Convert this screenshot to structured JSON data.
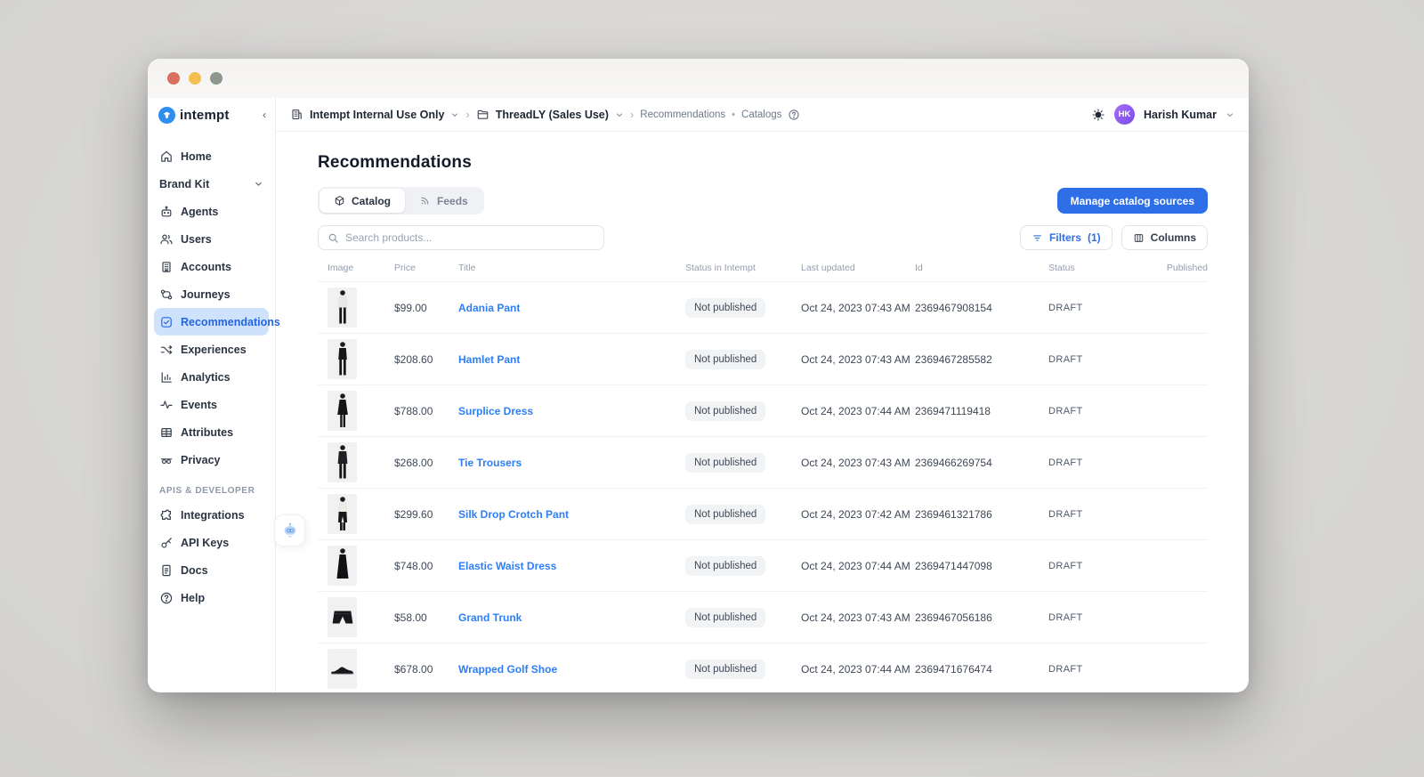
{
  "window": {
    "controls": [
      "close",
      "minimize",
      "maximize"
    ]
  },
  "sidebar": {
    "logo_text": "intempt",
    "collapse_glyph": "‹",
    "items": [
      {
        "label": "Home",
        "icon": "home-icon"
      },
      {
        "label": "Brand Kit",
        "icon": null,
        "chevron": true
      },
      {
        "label": "Agents",
        "icon": "robot-icon"
      },
      {
        "label": "Users",
        "icon": "users-icon"
      },
      {
        "label": "Accounts",
        "icon": "building-icon"
      },
      {
        "label": "Journeys",
        "icon": "journey-icon"
      },
      {
        "label": "Recommendations",
        "icon": "recommendation-icon",
        "selected": true
      },
      {
        "label": "Experiences",
        "icon": "shuffle-icon"
      },
      {
        "label": "Analytics",
        "icon": "bar-chart-icon"
      },
      {
        "label": "Events",
        "icon": "pulse-icon"
      },
      {
        "label": "Attributes",
        "icon": "table-icon"
      },
      {
        "label": "Privacy",
        "icon": "mask-icon"
      }
    ],
    "section_label": "APIS & DEVELOPER",
    "dev_items": [
      {
        "label": "Integrations",
        "icon": "puzzle-icon"
      },
      {
        "label": "API Keys",
        "icon": "key-icon"
      },
      {
        "label": "Docs",
        "icon": "document-icon"
      },
      {
        "label": "Help",
        "icon": "help-circle-icon"
      }
    ]
  },
  "topbar": {
    "org": "Intempt Internal Use Only",
    "project": "ThreadLY (Sales Use)",
    "section": "Recommendations",
    "page": "Catalogs",
    "separator": "›",
    "dot_separator": "•",
    "user_name": "Harish Kumar",
    "user_initials": "HK"
  },
  "main": {
    "title": "Recommendations",
    "tabs": [
      {
        "label": "Catalog",
        "icon": "package-icon",
        "active": true
      },
      {
        "label": "Feeds",
        "icon": "rss-icon",
        "active": false
      }
    ],
    "manage_button": "Manage catalog sources",
    "search_placeholder": "Search products...",
    "filters_label": "Filters",
    "filters_count": "(1)",
    "columns_label": "Columns"
  },
  "table": {
    "headers": [
      "Image",
      "Price",
      "Title",
      "Status in Intempt",
      "Last updated",
      "Id",
      "Status",
      "Published"
    ],
    "rows": [
      {
        "price": "$99.00",
        "title": "Adania Pant",
        "status_intempt": "Not published",
        "last_updated": "Oct 24, 2023 07:43 AM",
        "id": "2369467908154",
        "status": "DRAFT"
      },
      {
        "price": "$208.60",
        "title": "Hamlet Pant",
        "status_intempt": "Not published",
        "last_updated": "Oct 24, 2023 07:43 AM",
        "id": "2369467285582",
        "status": "DRAFT"
      },
      {
        "price": "$788.00",
        "title": "Surplice Dress",
        "status_intempt": "Not published",
        "last_updated": "Oct 24, 2023 07:44 AM",
        "id": "2369471119418",
        "status": "DRAFT"
      },
      {
        "price": "$268.00",
        "title": "Tie Trousers",
        "status_intempt": "Not published",
        "last_updated": "Oct 24, 2023 07:43 AM",
        "id": "2369466269754",
        "status": "DRAFT"
      },
      {
        "price": "$299.60",
        "title": "Silk Drop Crotch Pant",
        "status_intempt": "Not published",
        "last_updated": "Oct 24, 2023 07:42 AM",
        "id": "2369461321786",
        "status": "DRAFT"
      },
      {
        "price": "$748.00",
        "title": "Elastic Waist Dress",
        "status_intempt": "Not published",
        "last_updated": "Oct 24, 2023 07:44 AM",
        "id": "2369471447098",
        "status": "DRAFT"
      },
      {
        "price": "$58.00",
        "title": "Grand Trunk",
        "status_intempt": "Not published",
        "last_updated": "Oct 24, 2023 07:43 AM",
        "id": "2369467056186",
        "status": "DRAFT"
      },
      {
        "price": "$678.00",
        "title": "Wrapped Golf Shoe",
        "status_intempt": "Not published",
        "last_updated": "Oct 24, 2023 07:44 AM",
        "id": "2369471676474",
        "status": "DRAFT"
      }
    ]
  },
  "icons": {
    "search-icon": "magnifier",
    "filter-icon": "funnel-lines",
    "columns-icon": "vertical-columns",
    "package-icon": "3d-box",
    "rss-icon": "feed-waves",
    "building-icon": "office-building",
    "folder-icon": "open-folder",
    "help-circle-icon": "question-in-circle",
    "theme-toggle-icon": "sun",
    "chevron-down-icon": "v",
    "robot-assistant-icon": "robot-head"
  },
  "colors": {
    "accent": "#2e6fe8",
    "link": "#2d7ef7",
    "selected_nav_bg": "#cfe2fb",
    "badge_bg": "#f2f3f5",
    "traffic_red": "#d9705c",
    "traffic_yellow": "#f2c04e",
    "traffic_gray": "#8f978d",
    "avatar_gradient": "#a66ef6"
  }
}
